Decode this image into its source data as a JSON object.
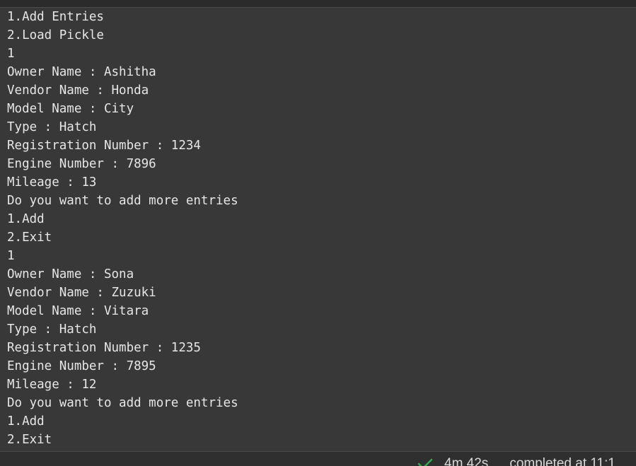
{
  "output_lines": [
    "1.Add Entries",
    "2.Load Pickle",
    "1",
    "Owner Name : Ashitha",
    "Vendor Name : Honda",
    "Model Name : City",
    "Type : Hatch",
    "Registration Number : 1234",
    "Engine Number : 7896",
    "Mileage : 13",
    "Do you want to add more entries",
    "1.Add",
    "2.Exit",
    "1",
    "Owner Name : Sona",
    "Vendor Name : Zuzuki",
    "Model Name : Vitara",
    "Type : Hatch",
    "Registration Number : 1235",
    "Engine Number : 7895",
    "Mileage : 12",
    "Do you want to add more entries",
    "1.Add",
    "2.Exit"
  ],
  "status": {
    "icon": "check-icon",
    "icon_color": "#34a853",
    "duration": "4m 42s",
    "completed": "completed at 11:1"
  }
}
